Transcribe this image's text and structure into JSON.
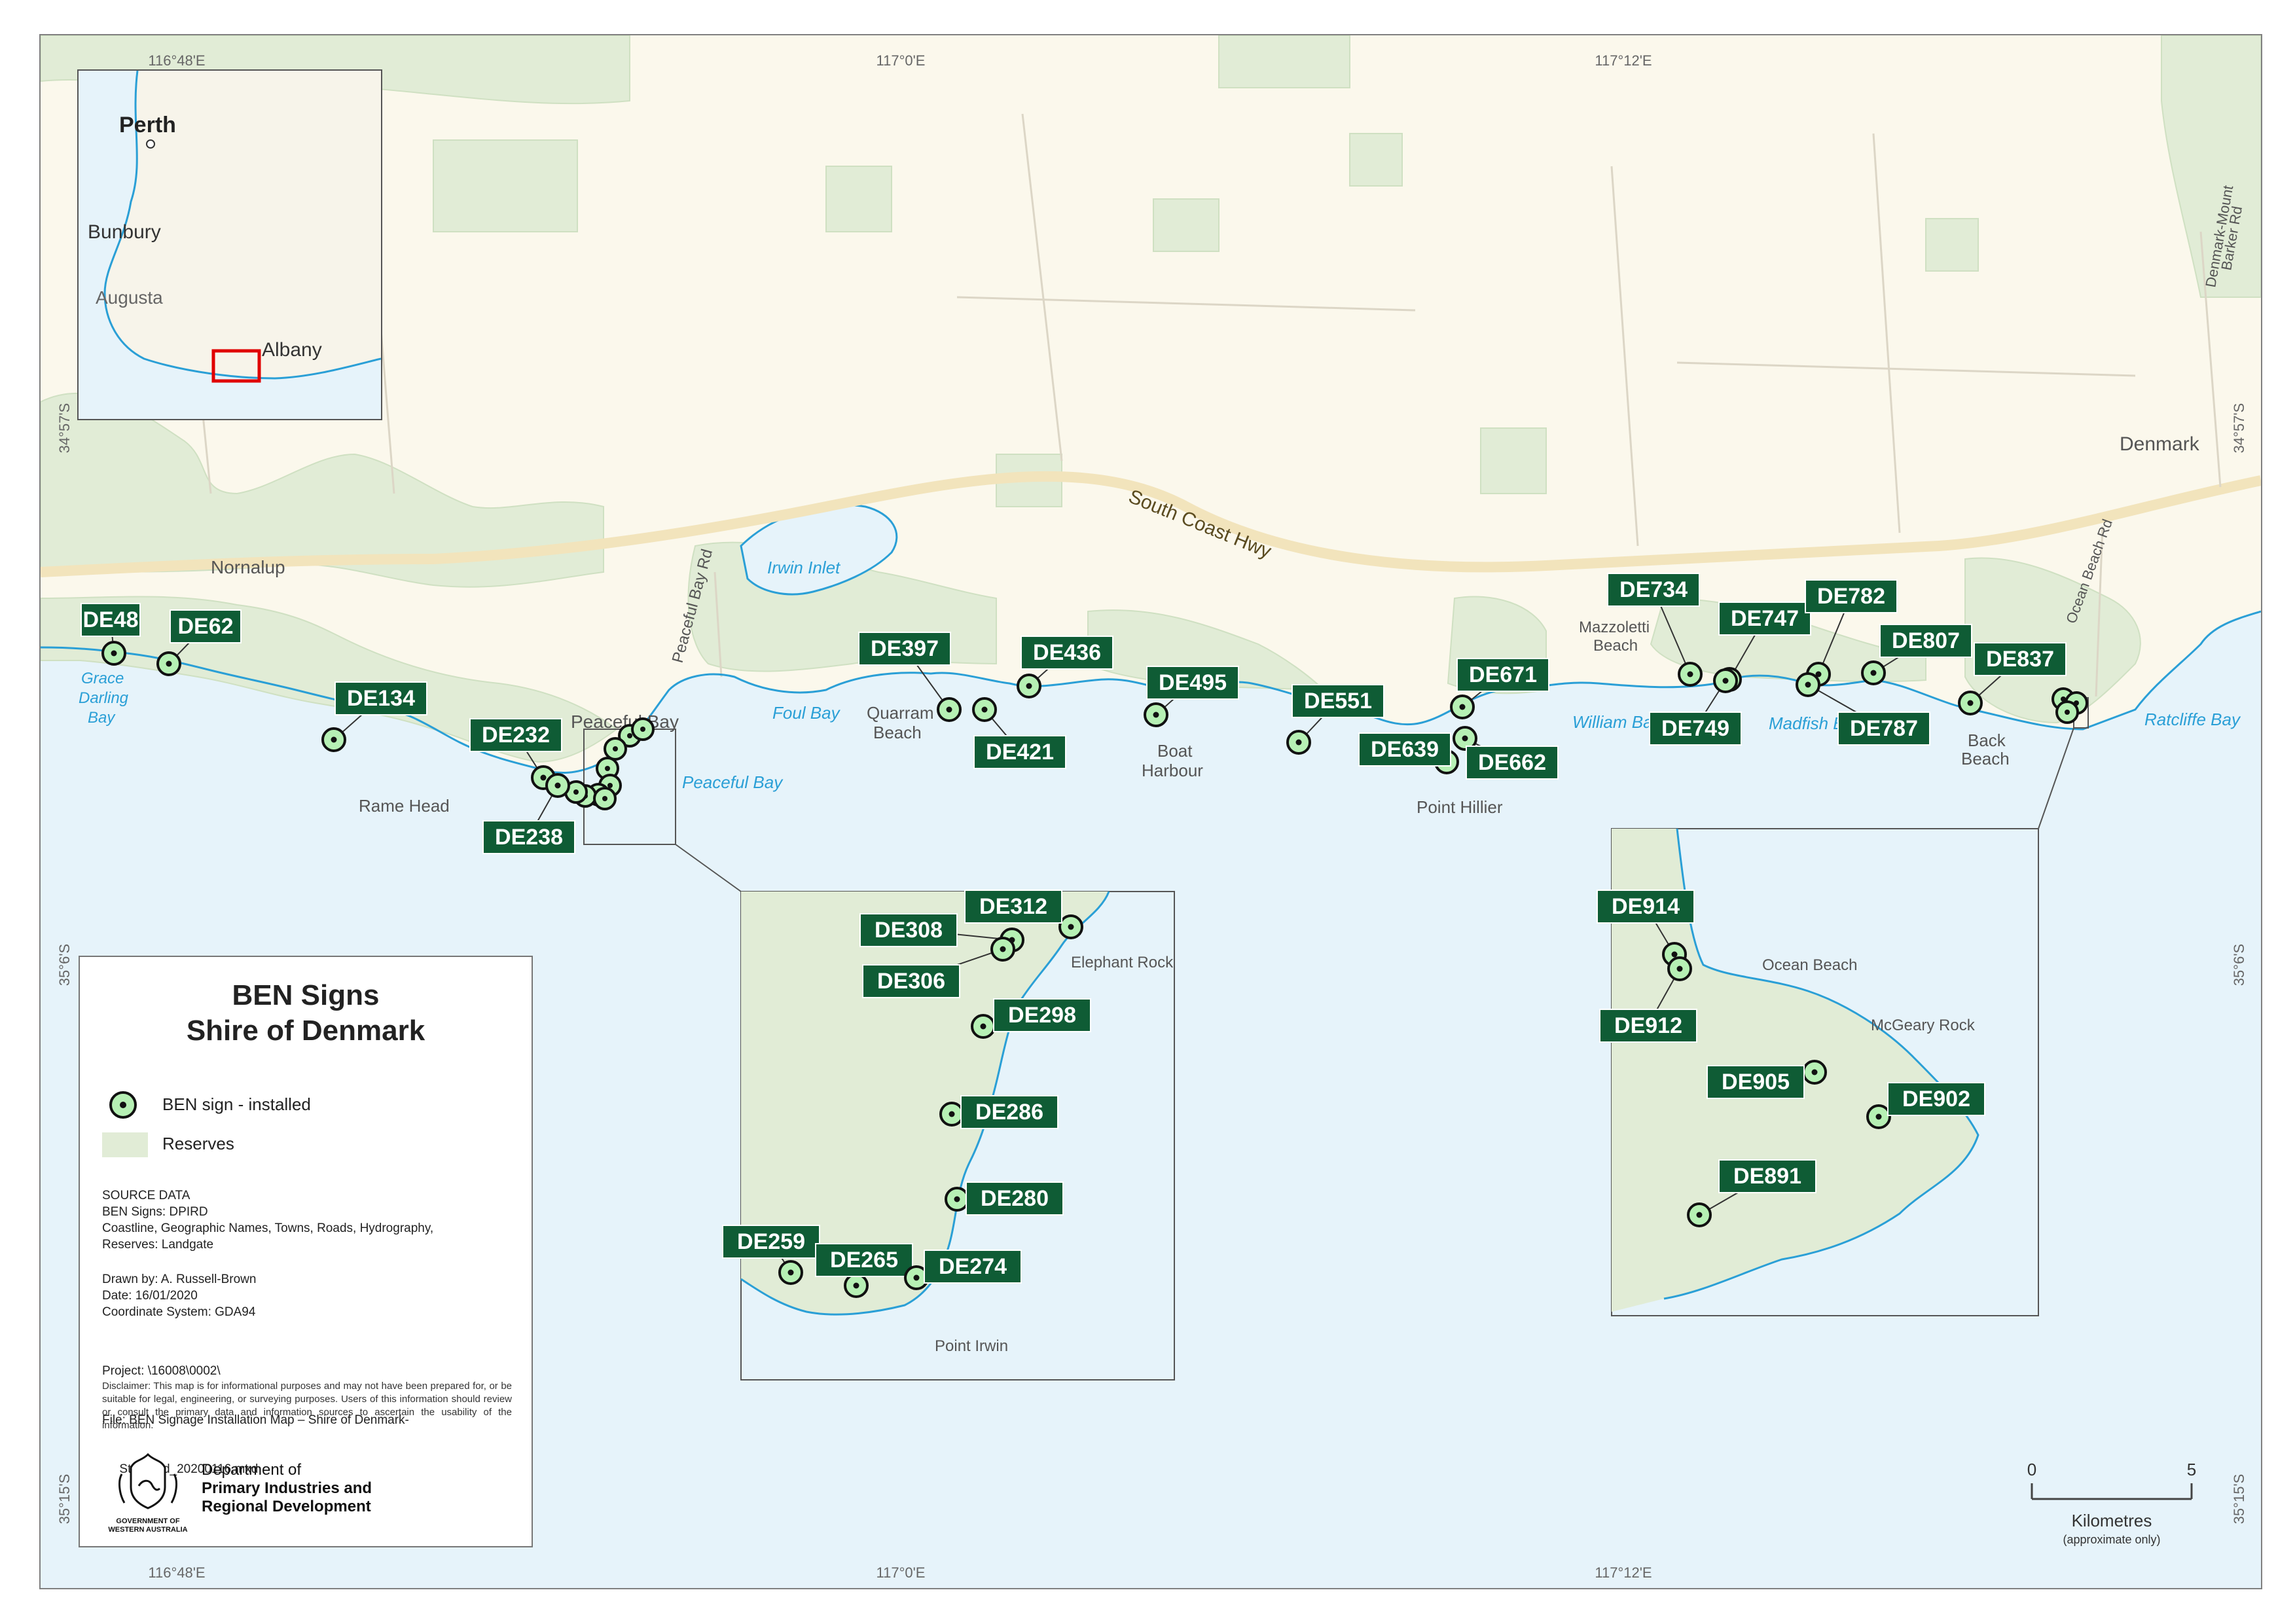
{
  "map": {
    "title_line1": "BEN Signs",
    "title_line2": "Shire of Denmark",
    "colors": {
      "sea": "#e6f3fa",
      "land": "#fbf8ec",
      "reserve": "#e1ecd6",
      "sign_fill": "#b6f0b4",
      "label_bg": "#0f5c35",
      "label_text": "#ffffff",
      "road": "#f2e4bc",
      "inset_frame": "#e00000"
    }
  },
  "legend": {
    "title_line1": "BEN Signs",
    "title_line2": "Shire of Denmark",
    "sign_label": "BEN sign - installed",
    "reserve_label": "Reserves",
    "source_lines": [
      "SOURCE DATA",
      "BEN Signs: DPIRD",
      "Coastline, Geographic Names, Towns, Roads, Hydrography,",
      "Reserves: Landgate"
    ],
    "drawn_lines": [
      "Drawn by: A. Russell-Brown",
      "Date: 16/01/2020",
      "Coordinate System: GDA94"
    ],
    "project_lines": [
      "Project: \\16008\\0002\\",
      "File: BEN Signage Installation Map – Shire of Denmark-",
      "     Standard_20200116.mxd"
    ],
    "disclaimer": "Disclaimer: This map is for informational purposes and may not have been prepared for, or be suitable for legal, engineering, or surveying purposes. Users of this information should review or consult the primary data and information sources to ascertain the usability of the information.",
    "gov_line1": "GOVERNMENT OF",
    "gov_line2": "WESTERN AUSTRALIA",
    "dept_line1": "Department of",
    "dept_line2": "Primary Industries and",
    "dept_line3": "Regional Development"
  },
  "locator": {
    "places": [
      "Perth",
      "Bunbury",
      "Augusta",
      "Albany"
    ]
  },
  "graticule": {
    "top": [
      "116°48'E",
      "117°0'E",
      "117°12'E"
    ],
    "bottom": [
      "116°48'E",
      "117°0'E",
      "117°12'E"
    ],
    "left": [
      "34°57'S",
      "35°6'S",
      "35°15'S"
    ],
    "right": [
      "34°57'S",
      "35°6'S",
      "35°15'S"
    ]
  },
  "scale": {
    "zero": "0",
    "five": "5",
    "unit": "Kilometres",
    "note": "(approximate only)"
  },
  "places": {
    "nornalup": "Nornalup",
    "irwin_inlet": "Irwin Inlet",
    "peaceful_bay_rd": "Peaceful Bay Rd",
    "south_coast_hwy": "South Coast Hwy",
    "grace1": "Grace",
    "grace2": "Darling",
    "grace3": "Bay",
    "rame_head": "Rame Head",
    "peaceful_bay": "Peaceful Bay",
    "peaceful_bay_water": "Peaceful Bay",
    "foul_bay": "Foul Bay",
    "quarram1": "Quarram",
    "quarram2": "Beach",
    "boat1": "Boat",
    "boat2": "Harbour",
    "point_hillier": "Point Hillier",
    "william_bay": "William Bay",
    "mazzoletti1": "Mazzoletti",
    "mazzoletti2": "Beach",
    "madfish_bay": "Madfish Bay",
    "back1": "Back",
    "back2": "Beach",
    "ratcliffe_bay": "Ratcliffe Bay",
    "denmark": "Denmark",
    "ocean_beach_rd": "Ocean Beach Rd",
    "dmb_rd1": "Denmark-Mount",
    "dmb_rd2": "Barker Rd",
    "elephant_rock": "Elephant Rock",
    "point_irwin": "Point Irwin",
    "ocean_beach": "Ocean Beach",
    "mcgeary_rock": "McGeary Rock"
  },
  "signs_main": [
    "DE48",
    "DE62",
    "DE134",
    "DE232",
    "DE238",
    "DE397",
    "DE421",
    "DE436",
    "DE495",
    "DE551",
    "DE639",
    "DE662",
    "DE671",
    "DE734",
    "DE747",
    "DE749",
    "DE782",
    "DE787",
    "DE807",
    "DE837"
  ],
  "signs_inset_west": [
    "DE312",
    "DE308",
    "DE306",
    "DE298",
    "DE286",
    "DE280",
    "DE259",
    "DE265",
    "DE274"
  ],
  "signs_inset_east": [
    "DE914",
    "DE912",
    "DE905",
    "DE902",
    "DE891"
  ]
}
